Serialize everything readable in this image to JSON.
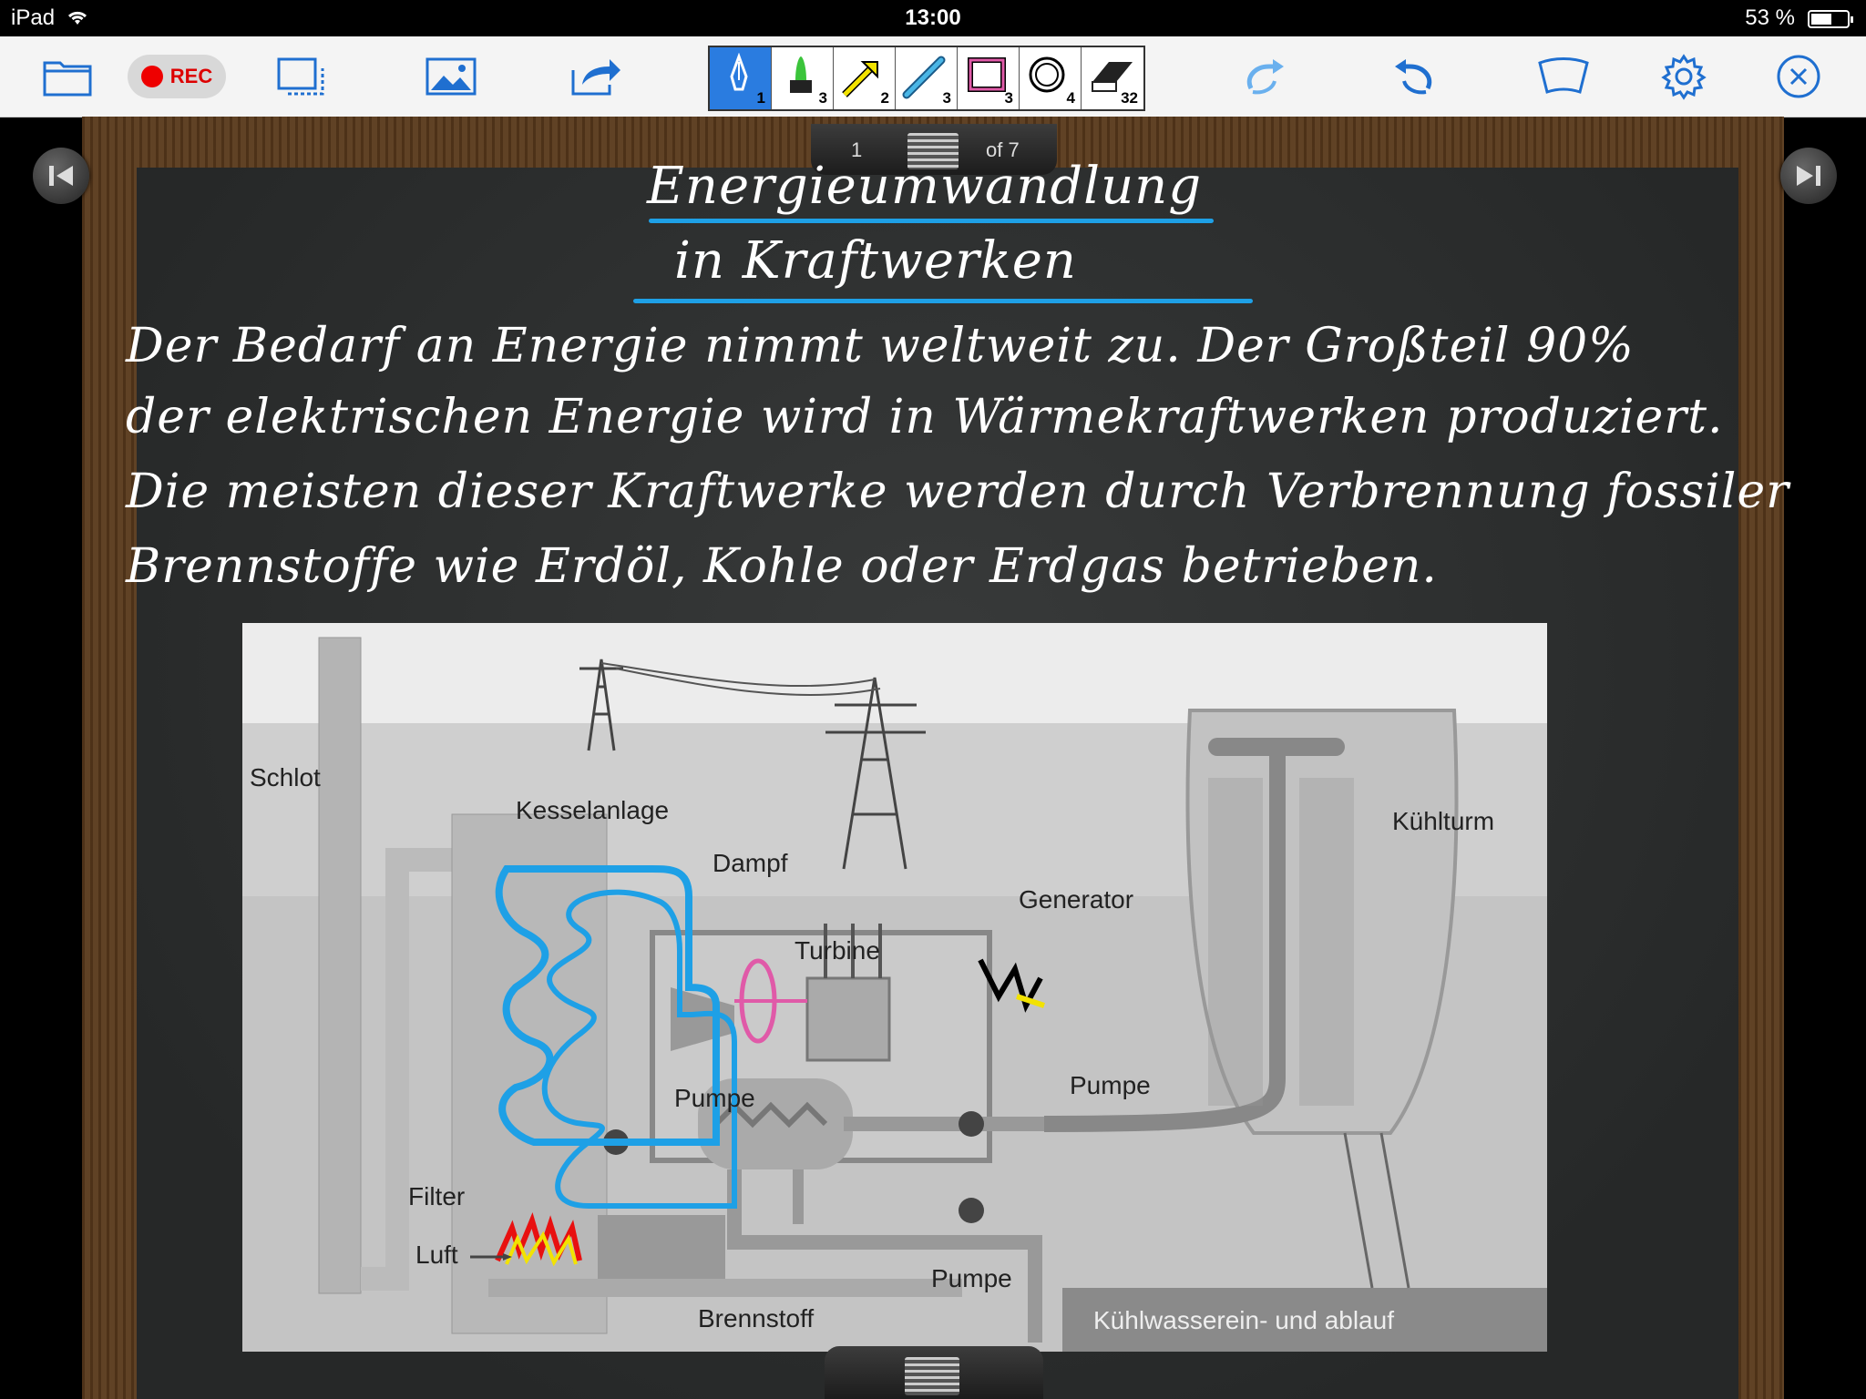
{
  "status_bar": {
    "device": "iPad",
    "time": "13:00",
    "battery": "53 %",
    "battery_level": 0.53
  },
  "toolbar": {
    "record_label": "REC",
    "tool_numbers": [
      "1",
      "3",
      "2",
      "3",
      "3",
      "4",
      "32"
    ]
  },
  "pager": {
    "current": "1",
    "of_text": "of 7"
  },
  "board": {
    "title_line1": "Energieumwandlung",
    "title_line2": "in Kraftwerken",
    "paragraph": [
      "Der Bedarf an Energie nimmt weltweit zu. Der Großteil 90%",
      "der elektrischen Energie wird in Wärmekraftwerken produziert.",
      "Die meisten dieser Kraftwerke werden durch Verbrennung fossiler",
      "Brennstoffe wie Erdöl, Kohle oder Erdgas betrieben."
    ]
  },
  "diagram": {
    "labels": {
      "schlot": "Schlot",
      "kesselanlage": "Kesselanlage",
      "dampf": "Dampf",
      "generator": "Generator",
      "turbine": "Turbine",
      "kuehlturm": "Kühlturm",
      "pumpe1": "Pumpe",
      "pumpe2": "Pumpe",
      "pumpe3": "Pumpe",
      "filter": "Filter",
      "luft": "Luft",
      "brennstoff": "Brennstoff",
      "kuehlwasser": "Kühlwasserein- und ablauf"
    }
  },
  "colors": {
    "accent": "#2a7ce0",
    "pen_blue": "#1ea0e6",
    "pen_pink": "#e05aa8",
    "pen_yellow": "#f2e200",
    "rec": "#e00000"
  }
}
